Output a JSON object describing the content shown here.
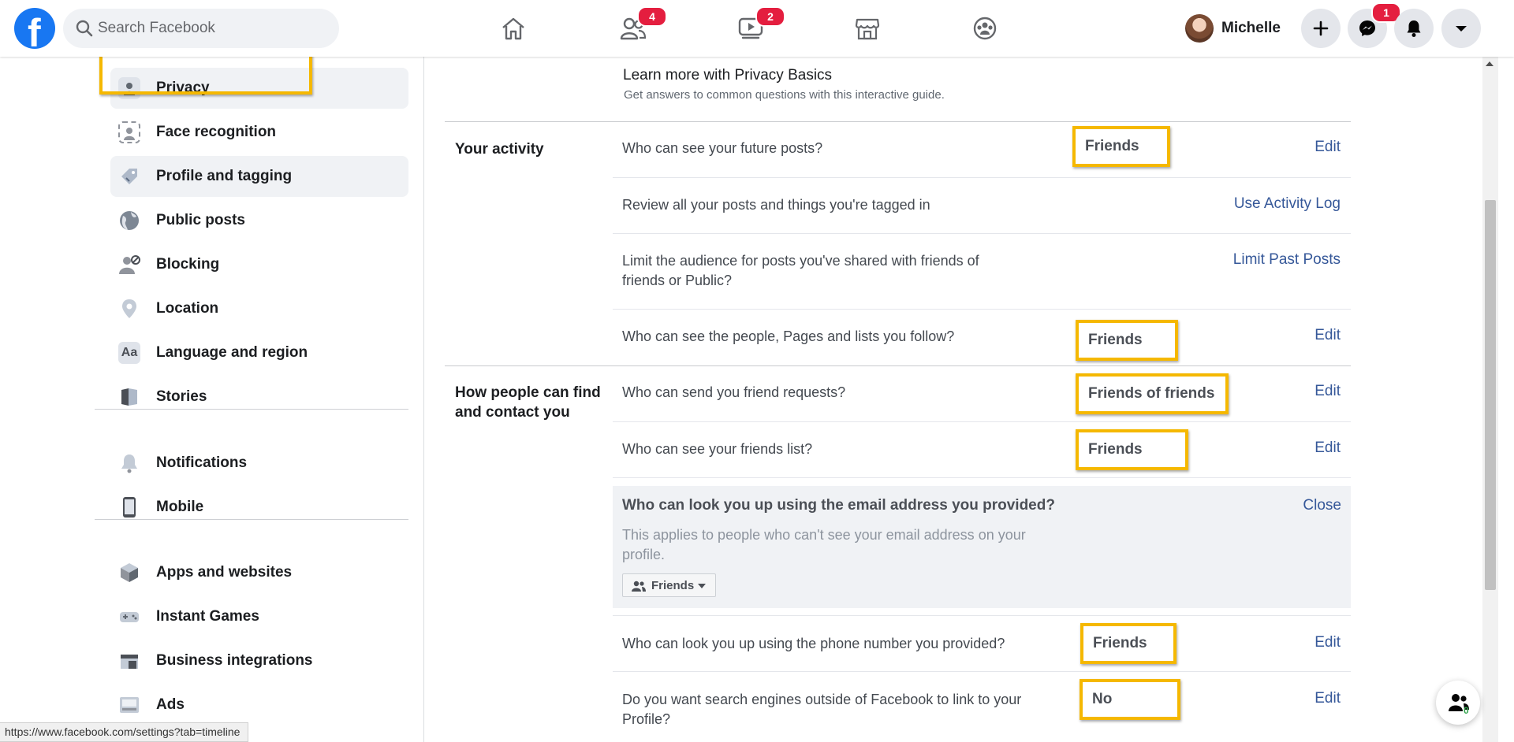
{
  "topbar": {
    "search_placeholder": "Search Facebook",
    "friends_badge": "4",
    "watch_badge": "2",
    "messenger_badge": "1",
    "profile_name": "Michelle"
  },
  "sidebar": {
    "items": [
      {
        "label": "Privacy",
        "icon": "privacy-icon"
      },
      {
        "label": "Face recognition",
        "icon": "face-recognition-icon"
      },
      {
        "label": "Profile and tagging",
        "icon": "tag-icon"
      },
      {
        "label": "Public posts",
        "icon": "globe-icon"
      },
      {
        "label": "Blocking",
        "icon": "blocking-icon"
      },
      {
        "label": "Location",
        "icon": "location-pin-icon"
      },
      {
        "label": "Language and region",
        "icon": "language-icon"
      },
      {
        "label": "Stories",
        "icon": "stories-icon"
      },
      {
        "label": "Notifications",
        "icon": "bell-icon"
      },
      {
        "label": "Mobile",
        "icon": "mobile-icon"
      },
      {
        "label": "Apps and websites",
        "icon": "cube-icon"
      },
      {
        "label": "Instant Games",
        "icon": "gamepad-icon"
      },
      {
        "label": "Business integrations",
        "icon": "business-icon"
      },
      {
        "label": "Ads",
        "icon": "ads-icon"
      }
    ]
  },
  "status_url": "https://www.facebook.com/settings?tab=timeline",
  "learn": {
    "title": "Learn more with Privacy Basics",
    "subtitle": "Get answers to common questions with this interactive guide."
  },
  "sections": {
    "activity_title": "Your activity",
    "find_title_line1": "How people can find",
    "find_title_line2": "and contact you"
  },
  "rows": {
    "future_posts": {
      "question": "Who can see your future posts?",
      "value": "Friends",
      "action": "Edit"
    },
    "review_posts": {
      "question": "Review all your posts and things you're tagged in",
      "action": "Use Activity Log"
    },
    "limit_past": {
      "question_line1": "Limit the audience for posts you've shared with friends of",
      "question_line2": "friends or Public?",
      "action": "Limit Past Posts"
    },
    "follow_list": {
      "question": "Who can see the people, Pages and lists you follow?",
      "value": "Friends",
      "action": "Edit"
    },
    "friend_requests": {
      "question": "Who can send you friend requests?",
      "value": "Friends of friends",
      "action": "Edit"
    },
    "friends_list": {
      "question": "Who can see your friends list?",
      "value": "Friends",
      "action": "Edit"
    },
    "email_lookup": {
      "question": "Who can look you up using the email address you provided?",
      "description_line1": "This applies to people who can't see your email address on your",
      "description_line2": "profile.",
      "selector": "Friends",
      "action": "Close"
    },
    "phone_lookup": {
      "question": "Who can look you up using the phone number you provided?",
      "value": "Friends",
      "action": "Edit"
    },
    "search_engines": {
      "question_line1": "Do you want search engines outside of Facebook to link to your",
      "question_line2": "Profile?",
      "value": "No",
      "action": "Edit"
    }
  },
  "chat": {
    "online_count": "0"
  },
  "colors": {
    "brand": "#1877f2",
    "link": "#365899",
    "highlight": "#f5b800",
    "badge": "#e41e3f"
  }
}
